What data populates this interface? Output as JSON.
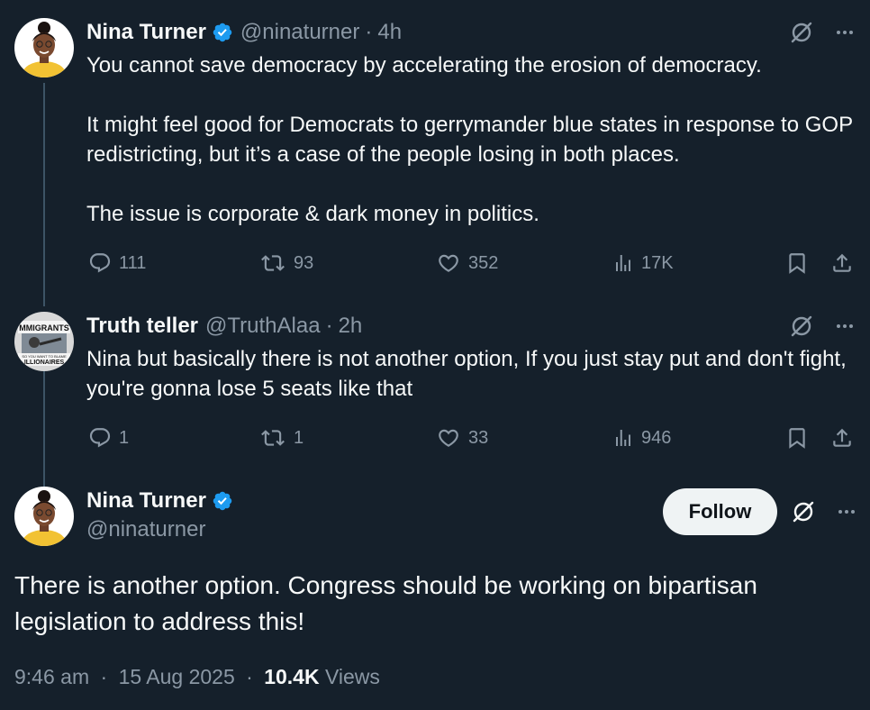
{
  "tweet1": {
    "name": "Nina Turner",
    "handle": "@ninaturner",
    "time": "4h",
    "text": "You cannot save democracy by accelerating the erosion of democracy.\n\nIt might feel good for Democrats to gerrymander blue states in response to GOP redistricting, but it’s a case of the people losing in both places.\n\nThe issue is corporate & dark money in politics.",
    "replies": "111",
    "reposts": "93",
    "likes": "352",
    "views": "17K"
  },
  "tweet2": {
    "name": "Truth teller",
    "handle": "@TruthAlaa",
    "time": "2h",
    "text": "Nina but basically there is not another option, If you just stay put and don't fight, you're gonna lose 5 seats like that",
    "replies": "1",
    "reposts": "1",
    "likes": "33",
    "views": "946",
    "avatar_sign_lines": [
      "MMIGRANTS",
      "SO YOU WANT TO BLAME",
      "ILLIONAIRES"
    ]
  },
  "main_tweet": {
    "name": "Nina Turner",
    "handle": "@ninaturner",
    "follow_label": "Follow",
    "text": "There is another option. Congress should be working on bipartisan legislation to address this!",
    "time": "9:46 am",
    "date": "15 Aug 2025",
    "views_count": "10.4K",
    "views_label": "Views"
  },
  "separator": "·",
  "colors": {
    "background": "#15202b",
    "text": "#f7f9f9",
    "muted": "#8b98a5",
    "verified": "#1d9bf0",
    "thread_line": "#3d5466"
  },
  "icons": [
    "verified-badge-icon",
    "grok-icon",
    "more-icon",
    "reply-icon",
    "repost-icon",
    "like-icon",
    "views-icon",
    "bookmark-icon",
    "share-icon"
  ]
}
